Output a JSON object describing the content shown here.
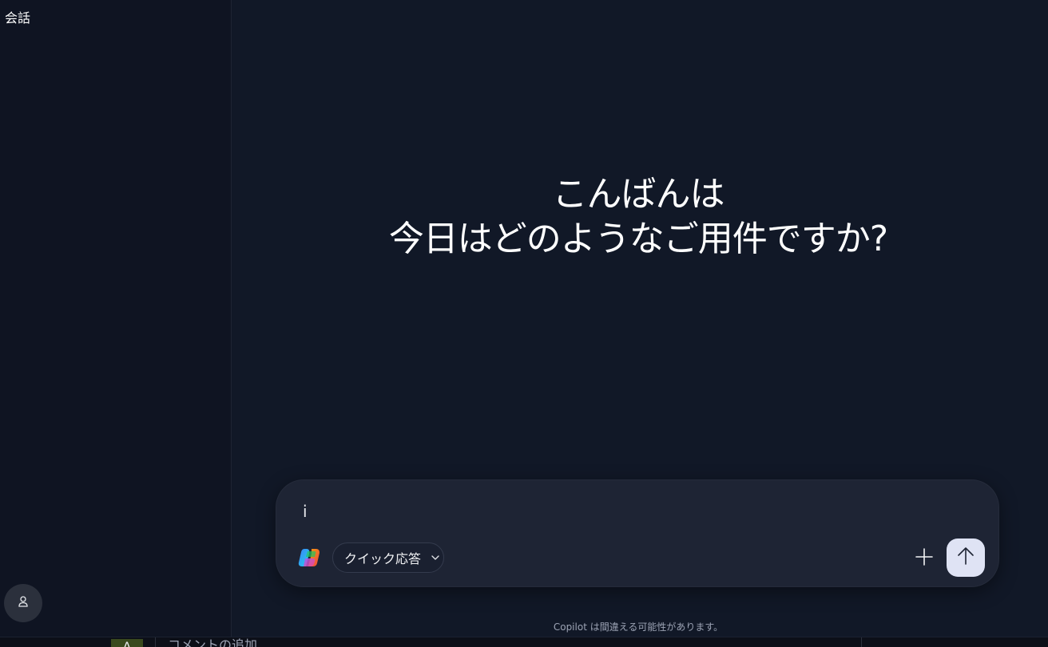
{
  "sidebar": {
    "title": "会話"
  },
  "greeting": {
    "line1": "こんばんは",
    "line2": "今日はどのようなご用件ですか?"
  },
  "composer": {
    "input_value": "i",
    "mode_label": "クイック応答"
  },
  "footer": {
    "disclaimer": "Copilot は間違える可能性があります。"
  },
  "background_window": {
    "avatar_letter": "A",
    "text": "コメントの追加"
  },
  "colors": {
    "background": "#111827",
    "sidebar": "#0f1422",
    "composer": "#1e2434",
    "send_button": "#dfe3f4"
  },
  "icons": {
    "profile": "person-icon",
    "logo": "copilot-logo-icon",
    "chevron": "chevron-down-icon",
    "add": "plus-icon",
    "send": "arrow-up-icon"
  }
}
